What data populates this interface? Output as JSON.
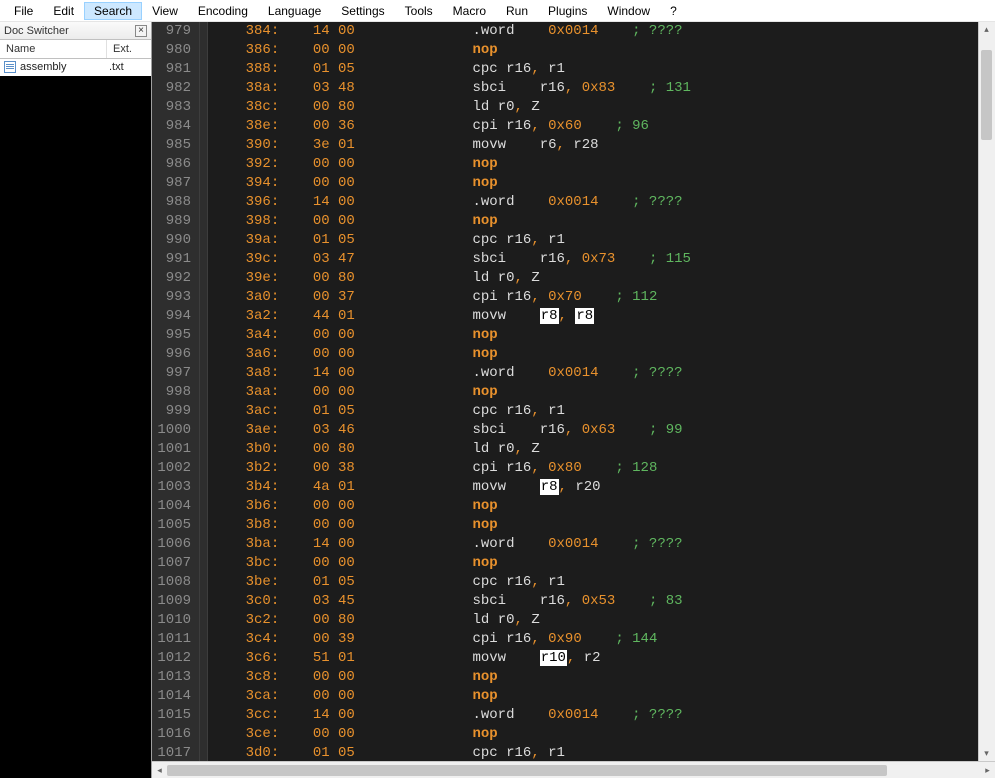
{
  "menubar": [
    "File",
    "Edit",
    "Search",
    "View",
    "Encoding",
    "Language",
    "Settings",
    "Tools",
    "Macro",
    "Run",
    "Plugins",
    "Window",
    "?"
  ],
  "menubar_active_index": 2,
  "doc_switcher": {
    "title": "Doc Switcher",
    "columns": {
      "name": "Name",
      "ext": "Ext."
    },
    "rows": [
      {
        "name": "assembly",
        "ext": ".txt"
      }
    ]
  },
  "highlight_token": "r8",
  "highlight_token_alt": "r10",
  "code_lines": [
    {
      "ln": 979,
      "addr": "384:",
      "hex": "14 00",
      "p1": ".word",
      "p2": "0x0014",
      "cm": "; ????"
    },
    {
      "ln": 980,
      "addr": "386:",
      "hex": "00 00",
      "p1": "nop",
      "kw": true
    },
    {
      "ln": 981,
      "addr": "388:",
      "hex": "01 05",
      "p1": "cpc r16, r1"
    },
    {
      "ln": 982,
      "addr": "38a:",
      "hex": "03 48",
      "p1": "sbci",
      "p2": "r16, 0x83",
      "cm": "; 131"
    },
    {
      "ln": 983,
      "addr": "38c:",
      "hex": "00 80",
      "p1": "ld  r0, Z"
    },
    {
      "ln": 984,
      "addr": "38e:",
      "hex": "00 36",
      "p1": "cpi r16, 0x60",
      "cm": "; 96"
    },
    {
      "ln": 985,
      "addr": "390:",
      "hex": "3e 01",
      "p1": "movw",
      "p2": "r6, r28"
    },
    {
      "ln": 986,
      "addr": "392:",
      "hex": "00 00",
      "p1": "nop",
      "kw": true
    },
    {
      "ln": 987,
      "addr": "394:",
      "hex": "00 00",
      "p1": "nop",
      "kw": true
    },
    {
      "ln": 988,
      "addr": "396:",
      "hex": "14 00",
      "p1": ".word",
      "p2": "0x0014",
      "cm": "; ????"
    },
    {
      "ln": 989,
      "addr": "398:",
      "hex": "00 00",
      "p1": "nop",
      "kw": true
    },
    {
      "ln": 990,
      "addr": "39a:",
      "hex": "01 05",
      "p1": "cpc r16, r1"
    },
    {
      "ln": 991,
      "addr": "39c:",
      "hex": "03 47",
      "p1": "sbci",
      "p2": "r16, 0x73",
      "cm": "; 115"
    },
    {
      "ln": 992,
      "addr": "39e:",
      "hex": "00 80",
      "p1": "ld  r0, Z"
    },
    {
      "ln": 993,
      "addr": "3a0:",
      "hex": "00 37",
      "p1": "cpi r16, 0x70",
      "cm": "; 112"
    },
    {
      "ln": 994,
      "addr": "3a2:",
      "hex": "44 01",
      "p1": "movw",
      "p2": "[r8], [r8]",
      "hl": true
    },
    {
      "ln": 995,
      "addr": "3a4:",
      "hex": "00 00",
      "p1": "nop",
      "kw": true
    },
    {
      "ln": 996,
      "addr": "3a6:",
      "hex": "00 00",
      "p1": "nop",
      "kw": true
    },
    {
      "ln": 997,
      "addr": "3a8:",
      "hex": "14 00",
      "p1": ".word",
      "p2": "0x0014",
      "cm": "; ????"
    },
    {
      "ln": 998,
      "addr": "3aa:",
      "hex": "00 00",
      "p1": "nop",
      "kw": true
    },
    {
      "ln": 999,
      "addr": "3ac:",
      "hex": "01 05",
      "p1": "cpc r16, r1"
    },
    {
      "ln": 1000,
      "addr": "3ae:",
      "hex": "03 46",
      "p1": "sbci",
      "p2": "r16, 0x63",
      "cm": "; 99"
    },
    {
      "ln": 1001,
      "addr": "3b0:",
      "hex": "00 80",
      "p1": "ld  r0, Z"
    },
    {
      "ln": 1002,
      "addr": "3b2:",
      "hex": "00 38",
      "p1": "cpi r16, 0x80",
      "cm": "; 128"
    },
    {
      "ln": 1003,
      "addr": "3b4:",
      "hex": "4a 01",
      "p1": "movw",
      "p2": "[r8], r20",
      "hl": true
    },
    {
      "ln": 1004,
      "addr": "3b6:",
      "hex": "00 00",
      "p1": "nop",
      "kw": true
    },
    {
      "ln": 1005,
      "addr": "3b8:",
      "hex": "00 00",
      "p1": "nop",
      "kw": true
    },
    {
      "ln": 1006,
      "addr": "3ba:",
      "hex": "14 00",
      "p1": ".word",
      "p2": "0x0014",
      "cm": "; ????"
    },
    {
      "ln": 1007,
      "addr": "3bc:",
      "hex": "00 00",
      "p1": "nop",
      "kw": true
    },
    {
      "ln": 1008,
      "addr": "3be:",
      "hex": "01 05",
      "p1": "cpc r16, r1"
    },
    {
      "ln": 1009,
      "addr": "3c0:",
      "hex": "03 45",
      "p1": "sbci",
      "p2": "r16, 0x53",
      "cm": "; 83"
    },
    {
      "ln": 1010,
      "addr": "3c2:",
      "hex": "00 80",
      "p1": "ld  r0, Z"
    },
    {
      "ln": 1011,
      "addr": "3c4:",
      "hex": "00 39",
      "p1": "cpi r16, 0x90",
      "cm": "; 144"
    },
    {
      "ln": 1012,
      "addr": "3c6:",
      "hex": "51 01",
      "p1": "movw",
      "p2": "[r10], r2",
      "hl": true
    },
    {
      "ln": 1013,
      "addr": "3c8:",
      "hex": "00 00",
      "p1": "nop",
      "kw": true
    },
    {
      "ln": 1014,
      "addr": "3ca:",
      "hex": "00 00",
      "p1": "nop",
      "kw": true
    },
    {
      "ln": 1015,
      "addr": "3cc:",
      "hex": "14 00",
      "p1": ".word",
      "p2": "0x0014",
      "cm": "; ????"
    },
    {
      "ln": 1016,
      "addr": "3ce:",
      "hex": "00 00",
      "p1": "nop",
      "kw": true
    },
    {
      "ln": 1017,
      "addr": "3d0:",
      "hex": "01 05",
      "p1": "cpc r16, r1"
    }
  ]
}
